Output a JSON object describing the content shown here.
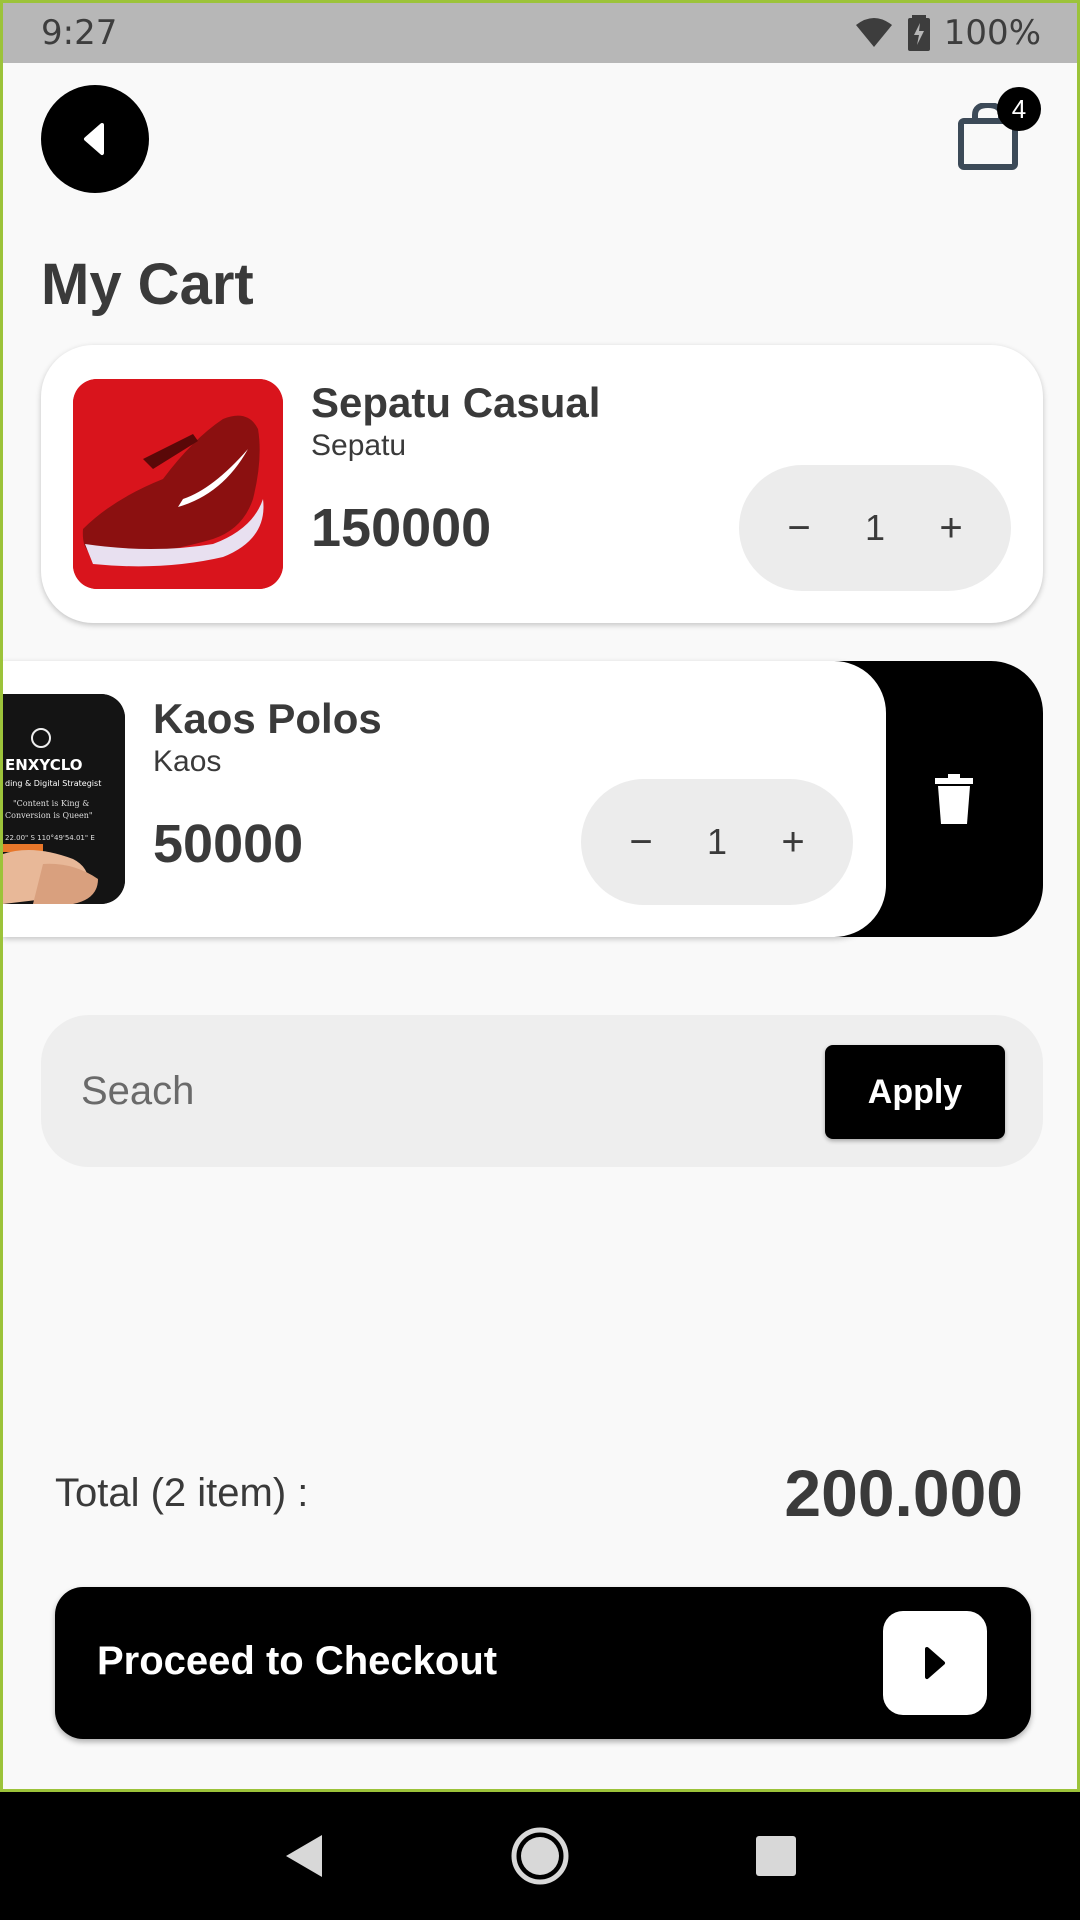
{
  "status_bar": {
    "time": "9:27",
    "battery": "100%"
  },
  "header": {
    "cart_count": "4"
  },
  "page": {
    "title": "My Cart"
  },
  "cart_items": [
    {
      "name": "Sepatu Casual",
      "category": "Sepatu",
      "price": "150000",
      "qty": "1"
    },
    {
      "name": "Kaos Polos",
      "category": "Kaos",
      "price": "50000",
      "qty": "1"
    }
  ],
  "coupon": {
    "placeholder": "Seach",
    "apply_label": "Apply"
  },
  "summary": {
    "total_label": "Total (2 item) :",
    "total_value": "200.000"
  },
  "checkout": {
    "label": "Proceed to Checkout"
  },
  "icons": {
    "back": "chevron-left-icon",
    "bag": "shopping-bag-icon",
    "delete": "trash-icon",
    "checkout_arrow": "play-arrow-icon"
  },
  "colors": {
    "accent": "#000000",
    "card_bg": "#ffffff",
    "stepper_bg": "#ececec",
    "product1_bg": "#d9141c"
  }
}
